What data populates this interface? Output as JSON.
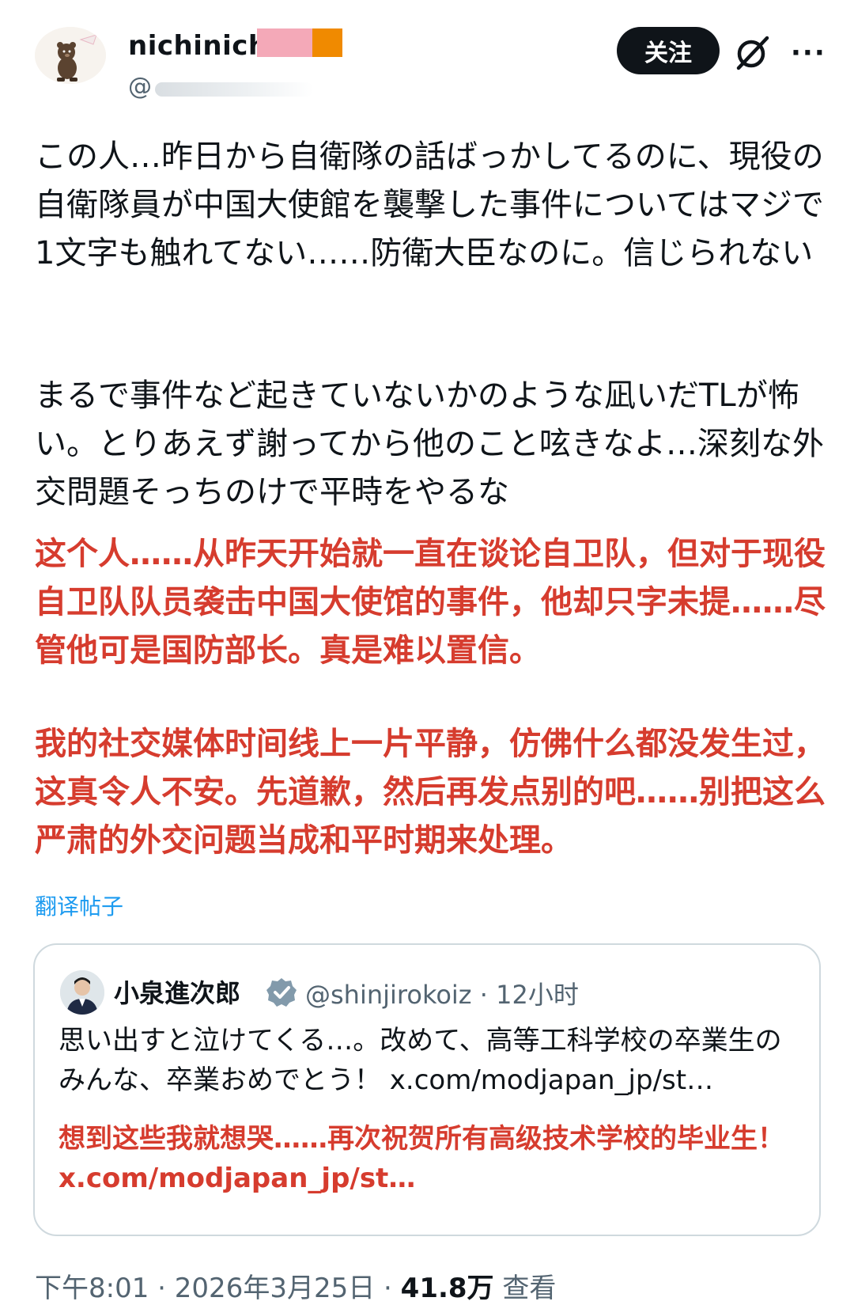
{
  "post": {
    "author": {
      "display_name": "nichinich",
      "handle_prefix": "@"
    },
    "follow_label": "关注",
    "more_label": "···",
    "text_jp_1": "この人…昨日から自衛隊の話ばっかしてるのに、現役の自衛隊員が中国大使館を襲撃した事件についてはマジで1文字も触れてない……防衛大臣なのに。信じられない",
    "text_jp_2": "まるで事件など起きていないかのような凪いだTLが怖い。とりあえず謝ってから他のこと呟きなよ…深刻な外交問題そっちのけで平時をやるな",
    "text_cn_1": "这个人……从昨天开始就一直在谈论自卫队，但对于现役自卫队队员袭击中国大使馆的事件，他却只字未提……尽管他可是国防部长。真是难以置信。",
    "text_cn_2": "我的社交媒体时间线上一片平静，仿佛什么都没发生过，这真令人不安。先道歉，然后再发点别的吧……别把这么严肃的外交问题当成和平时期来处理。",
    "translate_label": "翻译帖子"
  },
  "quote": {
    "name": "小泉進次郎",
    "handle": "@shinjirokoiz",
    "separator": " · ",
    "time": "12小时",
    "text_jp": "思い出すと泣けてくる…。改めて、高等工科学校の卒業生のみんな、卒業おめでとう！ x.com/modjapan_jp/st…",
    "text_cn": "想到这些我就想哭……再次祝贺所有高级技术学校的毕业生！ x.com/modjapan_jp/st…"
  },
  "footer": {
    "time": "下午8:01",
    "separator": " · ",
    "date": "2026年3月25日",
    "views_count": "41.8万",
    "views_label": "查看"
  },
  "colors": {
    "translation_red": "#d63c2e",
    "link_blue": "#1d9bf0",
    "muted_gray": "#536471",
    "follow_button_bg": "#0f1419"
  },
  "icons": {
    "grok": "grok-icon",
    "more": "more-icon",
    "verified": "verified-badge-icon"
  }
}
